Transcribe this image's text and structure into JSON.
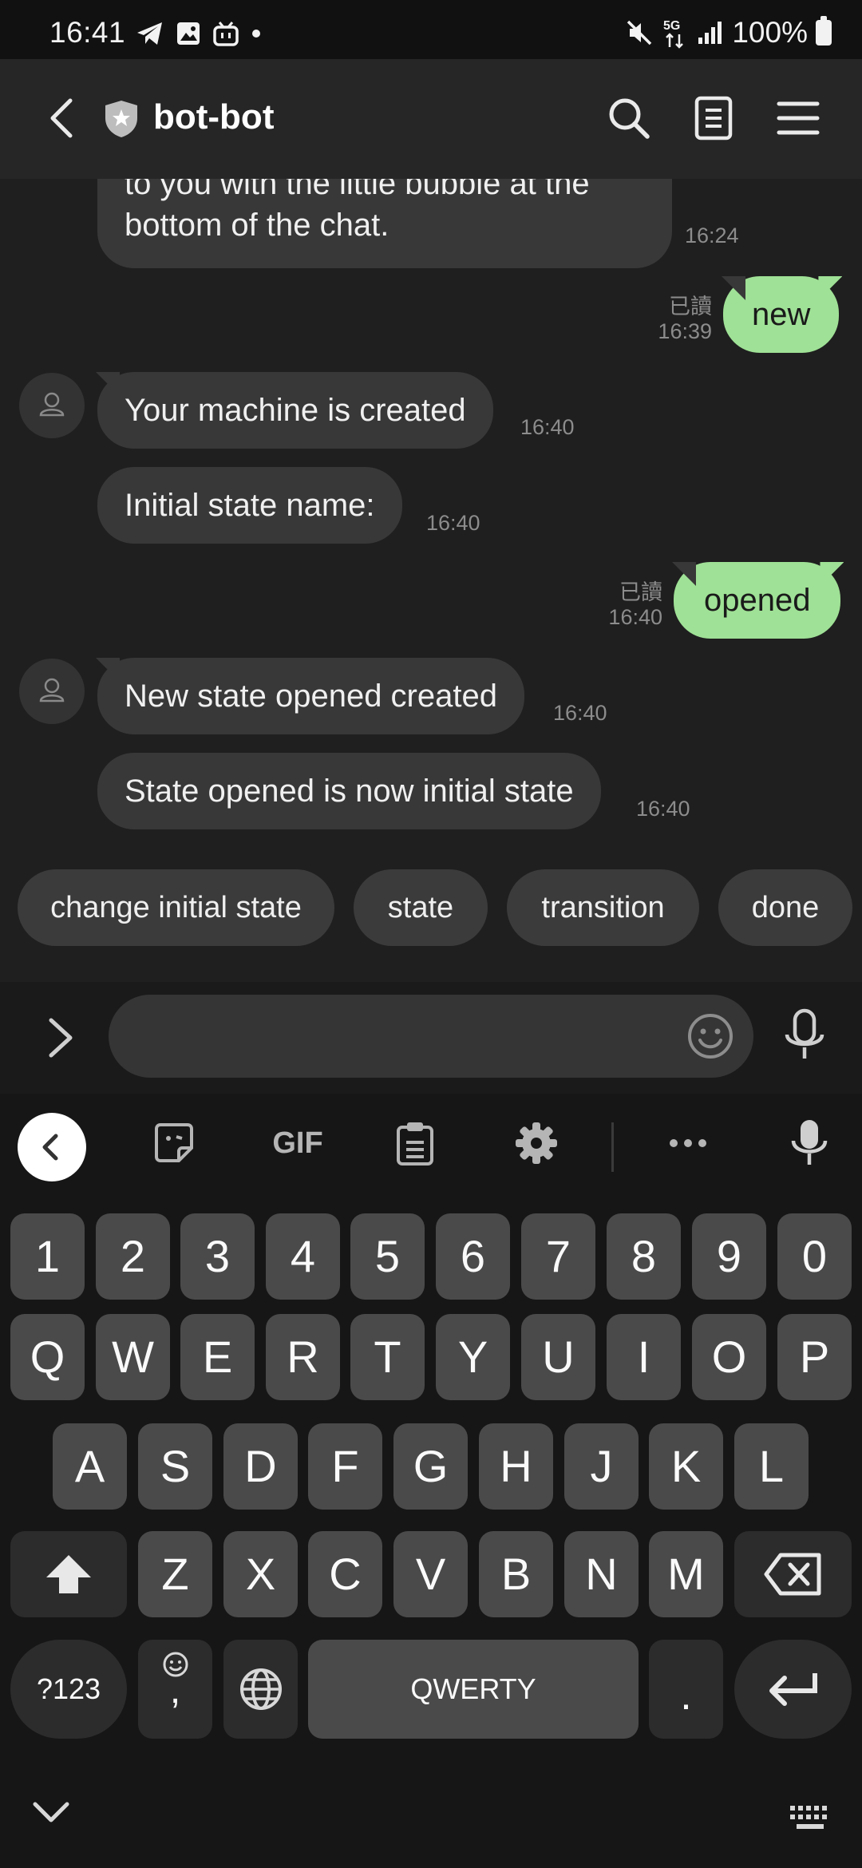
{
  "status_bar": {
    "time": "16:41",
    "battery": "100%",
    "network": "5G"
  },
  "header": {
    "title": "bot-bot"
  },
  "messages": [
    {
      "side": "in",
      "text": "to you with the little bubble at the bottom of the chat.",
      "time": "16:24"
    },
    {
      "side": "out",
      "text": "new",
      "read": "已讀",
      "time": "16:39"
    },
    {
      "side": "in",
      "text": "Your machine is created",
      "time": "16:40"
    },
    {
      "side": "in",
      "text": "Initial state name:",
      "time": "16:40"
    },
    {
      "side": "out",
      "text": "opened",
      "read": "已讀",
      "time": "16:40"
    },
    {
      "side": "in",
      "text": "New state opened created",
      "time": "16:40"
    },
    {
      "side": "in",
      "text": "State opened is now initial state",
      "time": "16:40"
    }
  ],
  "quick_replies": [
    "change initial state",
    "state",
    "transition",
    "done"
  ],
  "input": {
    "value": "",
    "placeholder": ""
  },
  "keyboard": {
    "toolbar": {
      "gif": "GIF"
    },
    "row_numbers": [
      "1",
      "2",
      "3",
      "4",
      "5",
      "6",
      "7",
      "8",
      "9",
      "0"
    ],
    "row_q": [
      "Q",
      "W",
      "E",
      "R",
      "T",
      "Y",
      "U",
      "I",
      "O",
      "P"
    ],
    "row_a": [
      "A",
      "S",
      "D",
      "F",
      "G",
      "H",
      "J",
      "K",
      "L"
    ],
    "row_z": [
      "Z",
      "X",
      "C",
      "V",
      "B",
      "N",
      "M"
    ],
    "symbols_key": "?123",
    "comma_key": ",",
    "space_label": "QWERTY",
    "period_key": "."
  },
  "colors": {
    "background": "#1f1f1f",
    "incoming_bubble": "#383838",
    "outgoing_bubble": "#9fe196",
    "key": "#4a4a4a"
  }
}
